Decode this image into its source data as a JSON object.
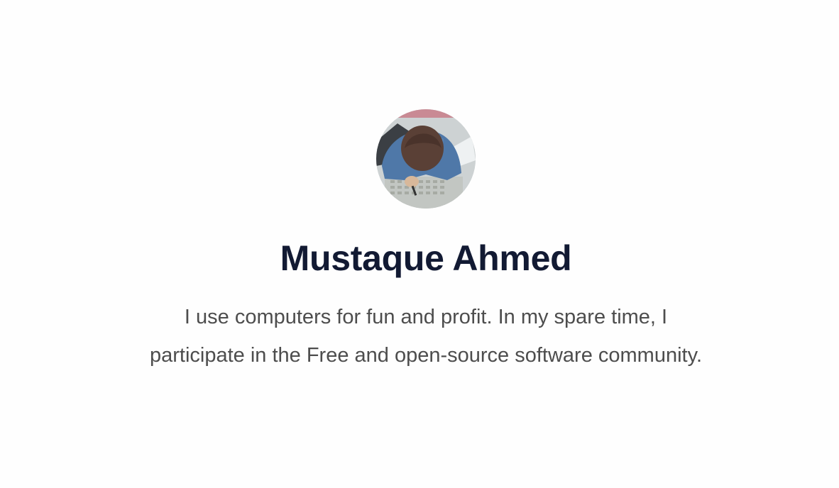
{
  "profile": {
    "name": "Mustaque Ahmed",
    "bio": "I use computers for fun and profit. In my spare time, I participate in the Free and open-source software community.",
    "avatar_icon": "illustrated-person-sleeping-on-desk"
  },
  "colors": {
    "background": "#fefefe",
    "name_text": "#121a33",
    "bio_text": "#4d4d4d"
  }
}
